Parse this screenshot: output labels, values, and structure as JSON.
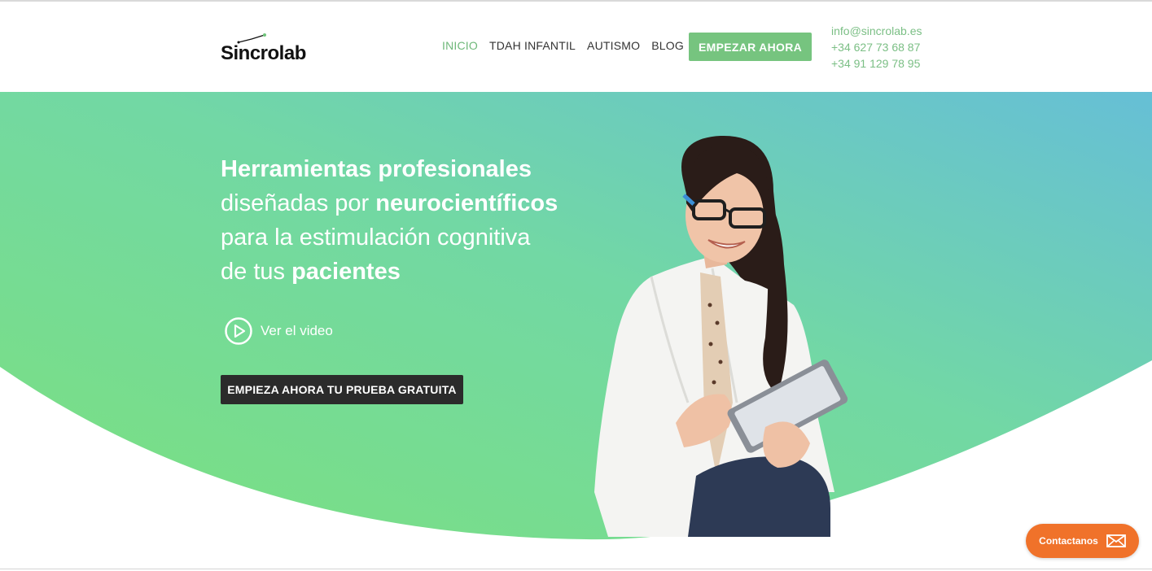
{
  "brand": {
    "name": "Sincrolab"
  },
  "nav": [
    {
      "label": "INICIO",
      "active": true
    },
    {
      "label": "TDAH INFANTIL"
    },
    {
      "label": "AUTISMO"
    },
    {
      "label": "BLOG"
    }
  ],
  "header_cta": "EMPEZAR AHORA",
  "contact": {
    "email": "info@sincrolab.es",
    "phone1": "+34 627 73 68 87",
    "phone2": "+34 91 129 78 95"
  },
  "hero": {
    "line1_bold": "Herramientas profesionales",
    "line2_regular": "diseñadas por ",
    "line2_bold": "neurocientíficos",
    "line3_regular": "para la estimulación cognitiva",
    "line4_regular": "de tus ",
    "line4_bold": "pacientes",
    "video_label": "Ver el video",
    "trial_button": "EMPIEZA AHORA TU PRUEBA GRATUITA"
  },
  "widget": {
    "label": "Contactanos",
    "icon": "envelope-icon"
  },
  "colors": {
    "accent_green": "#76c47f",
    "hero_start": "#7be07f",
    "hero_end": "#66bfd6",
    "cta_dark": "#2b2b2b",
    "widget_orange": "#f0722a"
  }
}
